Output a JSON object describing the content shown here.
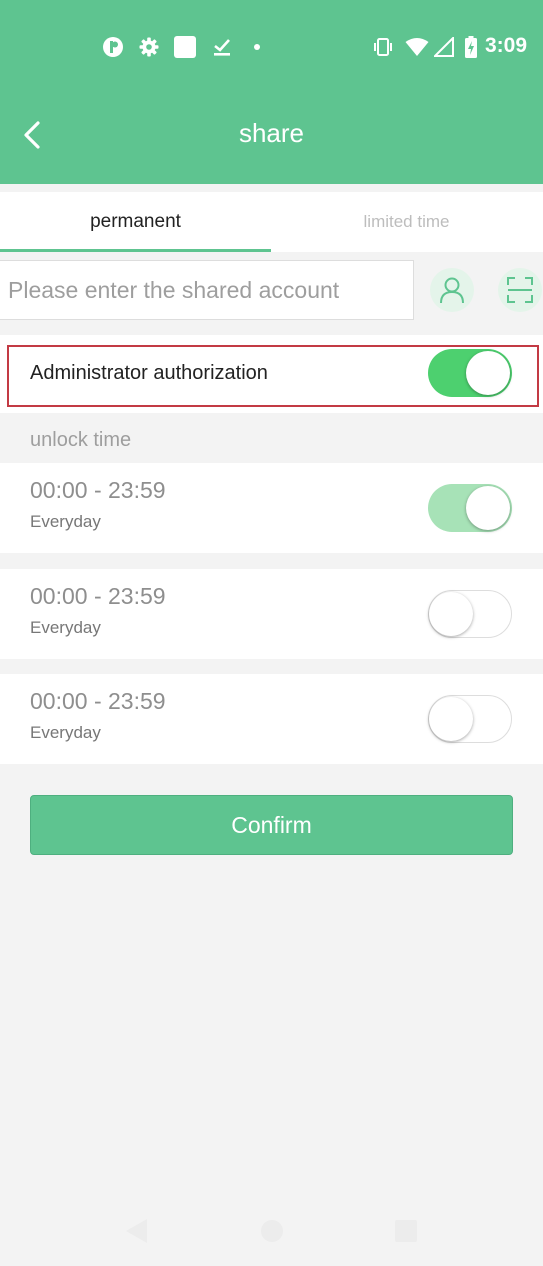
{
  "status_bar": {
    "time": "3:09",
    "left_icons": [
      "app-notification-icon",
      "settings-icon",
      "square-app-icon",
      "download-done-icon",
      "dot-icon"
    ],
    "right_icons": [
      "vibrate-icon",
      "wifi-icon",
      "cellular-signal-icon",
      "battery-charging-icon"
    ]
  },
  "header": {
    "title": "share",
    "back_icon": "chevron-left-icon"
  },
  "tabs": [
    {
      "label": "permanent",
      "active": true
    },
    {
      "label": "limited time",
      "active": false
    }
  ],
  "account": {
    "placeholder": "Please enter the shared account",
    "value": "",
    "contact_icon": "person-icon",
    "scan_icon": "scan-icon"
  },
  "admin": {
    "label": "Administrator authorization",
    "enabled": true
  },
  "unlock_section": {
    "label": "unlock time"
  },
  "time_slots": [
    {
      "range": "00:00 - 23:59",
      "days": "Everyday",
      "enabled": true
    },
    {
      "range": "00:00 - 23:59",
      "days": "Everyday",
      "enabled": false
    },
    {
      "range": "00:00 - 23:59",
      "days": "Everyday",
      "enabled": false
    }
  ],
  "confirm": {
    "label": "Confirm"
  },
  "nav_bar": {
    "icons": [
      "back-triangle-icon",
      "home-circle-icon",
      "recents-square-icon"
    ]
  },
  "colors": {
    "brand_green": "#5ec490",
    "toggle_on": "#4dd06f",
    "toggle_on_light": "#a7e2b7",
    "highlight_red": "#c33a44"
  }
}
